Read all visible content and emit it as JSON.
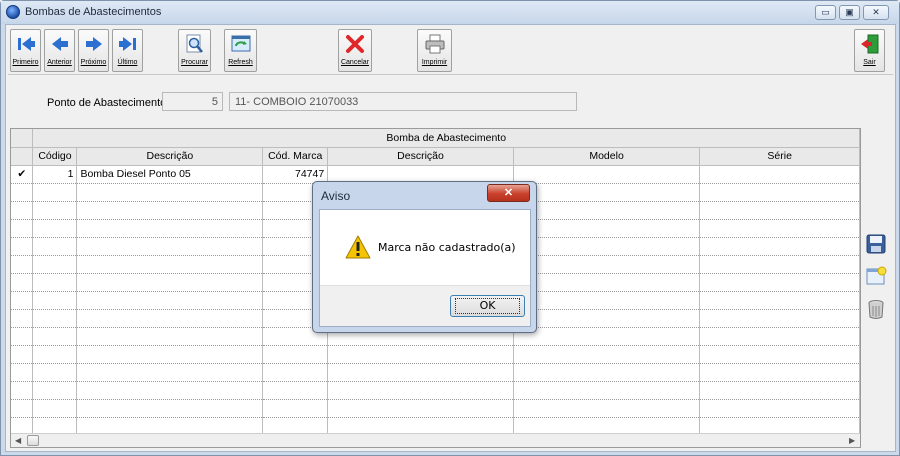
{
  "window": {
    "title": "Bombas de Abastecimentos",
    "controls": {
      "minimize": "▭",
      "maximize": "▣",
      "close": "✕"
    }
  },
  "toolbar": {
    "buttons": [
      {
        "label": "Primeiro",
        "icon": "first-record-icon"
      },
      {
        "label": "Anterior",
        "icon": "previous-record-icon"
      },
      {
        "label": "Próximo",
        "icon": "next-record-icon"
      },
      {
        "label": "Último",
        "icon": "last-record-icon"
      },
      {
        "label": "Procurar",
        "icon": "search-icon"
      },
      {
        "label": "Refresh",
        "icon": "refresh-icon"
      },
      {
        "label": "Cancelar",
        "icon": "cancel-icon"
      },
      {
        "label": "Imprimir",
        "icon": "printer-icon"
      },
      {
        "label": "Sair",
        "icon": "exit-icon"
      }
    ]
  },
  "ponto": {
    "label": "Ponto de Abastecimento:",
    "code": "5",
    "name": "11- COMBOIO 21070033"
  },
  "grid": {
    "group_header": "Bomba de Abastecimento",
    "columns": [
      "Código",
      "Descrição",
      "Cód. Marca",
      "Descrição",
      "Modelo",
      "Série"
    ],
    "rows": [
      {
        "indicator": "✔",
        "codigo": "1",
        "descricao": "Bomba Diesel Ponto 05",
        "cod_marca": "74747",
        "descricao_marca": "",
        "modelo": "",
        "serie": ""
      }
    ],
    "scroll_left": "◀",
    "scroll_right": "▶"
  },
  "side_icons": [
    "save-icon",
    "new-record-icon",
    "delete-icon"
  ],
  "dialog": {
    "title": "Aviso",
    "close": "✕",
    "message": "Marca não cadastrado(a)",
    "ok": "OK"
  }
}
